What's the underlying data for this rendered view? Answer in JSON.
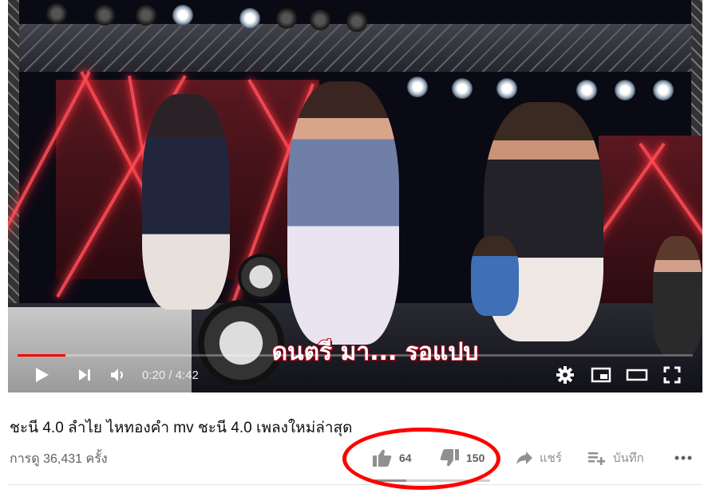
{
  "player": {
    "subtitle": "ดนตรี มา... รอแปบ",
    "current_time": "0:20",
    "duration": "4:42",
    "time_display": "0:20 / 4:42",
    "progress_fraction": 0.071,
    "icons": [
      "play-icon",
      "next-icon",
      "volume-icon",
      "settings-icon",
      "miniplayer-icon",
      "theater-icon",
      "fullscreen-icon"
    ],
    "accent_color": "#ff0000"
  },
  "video": {
    "title": "ชะนี 4.0 ลำไย ไหทองคำ mv ชะนี 4.0 เพลงใหม่ล่าสุด",
    "views": "การดู 36,431 ครั้ง"
  },
  "actions": {
    "like_count": "64",
    "dislike_count": "150",
    "share_label": "แชร์",
    "save_label": "บันทึก",
    "like_ratio": 0.3
  },
  "annotation": {
    "color": "#ff0000"
  }
}
